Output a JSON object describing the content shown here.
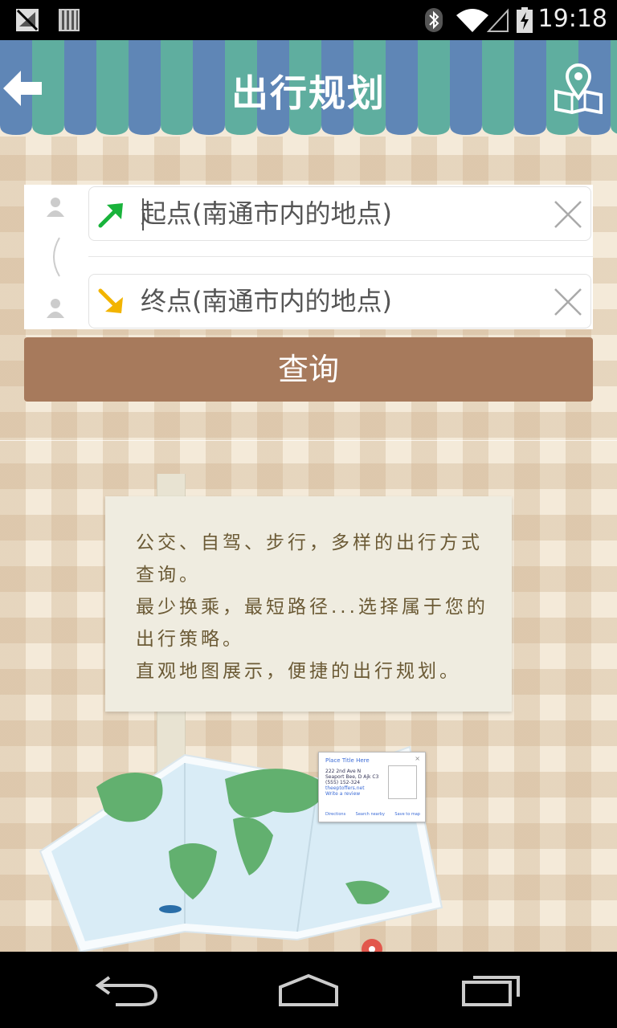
{
  "status_bar": {
    "time": "19:18",
    "icons": [
      "no-signal-icon",
      "storage-icon",
      "bluetooth-icon",
      "wifi-icon",
      "cell-signal-icon",
      "battery-charging-icon"
    ]
  },
  "toolbar": {
    "title": "出行规划",
    "back_icon": "back-arrow-icon",
    "map_icon": "map-pin-icon"
  },
  "search": {
    "start_placeholder": "起点(南通市内的地点)",
    "end_placeholder": "终点(南通市内的地点)",
    "start_arrow_color": "#19b33b",
    "end_arrow_color": "#f2b400"
  },
  "query_button": "查询",
  "sign": {
    "lines": [
      "公交、自驾、步行，多样的出行方式",
      "查询。",
      "最少换乘，最短路径...选择属于您的",
      "出行策略。",
      "直观地图展示，便捷的出行规划。"
    ]
  },
  "map_popup": {
    "title": "Place Title Here",
    "address_1": "222 2nd Ave N",
    "address_2": "Seaport Bee, D Ajk C3",
    "phone": "(555) 152-324",
    "website": "theeptoffers.net",
    "review": "Write a review",
    "links": [
      "Directions",
      "Search nearby",
      "Save to map"
    ]
  },
  "nav": [
    "back-nav-icon",
    "home-nav-icon",
    "recents-nav-icon"
  ]
}
